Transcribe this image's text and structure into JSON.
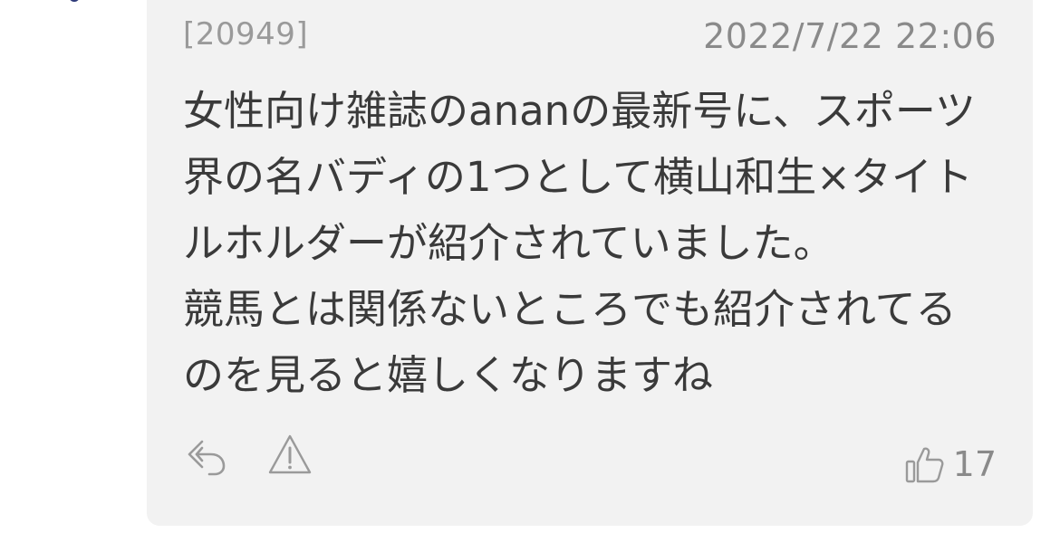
{
  "comment": {
    "id": "[20949]",
    "date": "2022/7/22 22:06",
    "body": "女性向け雑誌のananの最新号に、スポーツ界の名バディの1つとして横山和生×タイトルホルダーが紹介されていました。\n競馬とは関係ないところでも紹介されてるのを見ると嬉しくなりますね",
    "like_count": "17"
  },
  "icons": {
    "reply": "reply-icon",
    "report": "warning-icon",
    "like": "thumbs-up-icon"
  },
  "colors": {
    "card_background": "#f2f2f2",
    "body_text": "#3a3a3a",
    "meta_text": "#8a8a8a",
    "icon_stroke": "#9a9a9a"
  }
}
